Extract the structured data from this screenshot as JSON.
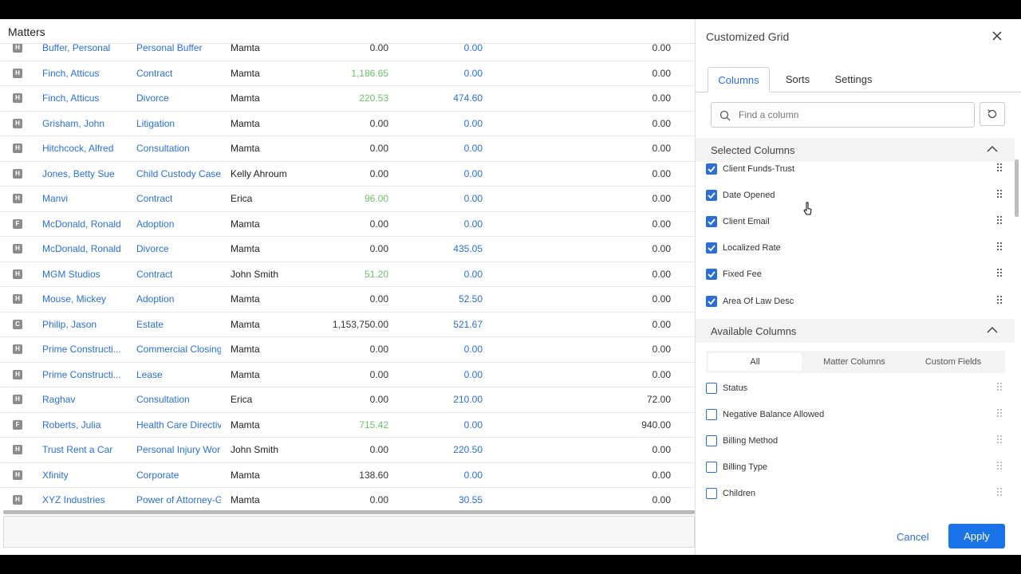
{
  "grid": {
    "title": "Matters",
    "rows": [
      {
        "badge": "H",
        "client": "Buffer, Personal",
        "area": "Personal Buffer",
        "atty": "Mamta",
        "n1": "0.00",
        "n2": "0.00",
        "n3": "0.00"
      },
      {
        "badge": "H",
        "client": "Finch, Atticus",
        "area": "Contract",
        "atty": "Mamta",
        "n1": "1,186.65",
        "n2": "0.00",
        "n3": "0.00"
      },
      {
        "badge": "H",
        "client": "Finch, Atticus",
        "area": "Divorce",
        "atty": "Mamta",
        "n1": "220.53",
        "n2": "474.60",
        "n3": "0.00"
      },
      {
        "badge": "H",
        "client": "Grisham, John",
        "area": "Litigation",
        "atty": "Mamta",
        "n1": "0.00",
        "n2": "0.00",
        "n3": "0.00"
      },
      {
        "badge": "H",
        "client": "Hitchcock, Alfred",
        "area": "Consultation",
        "atty": "Mamta",
        "n1": "0.00",
        "n2": "0.00",
        "n3": "0.00"
      },
      {
        "badge": "H",
        "client": "Jones, Betty Sue",
        "area": "Child Custody Case",
        "atty": "Kelly Ahroum",
        "n1": "0.00",
        "n2": "0.00",
        "n3": "0.00"
      },
      {
        "badge": "H",
        "client": "Manvi",
        "area": "Contract",
        "atty": "Erica",
        "n1": "96.00",
        "n2": "0.00",
        "n3": "0.00"
      },
      {
        "badge": "F",
        "client": "McDonald, Ronald",
        "area": "Adoption",
        "atty": "Mamta",
        "n1": "0.00",
        "n2": "0.00",
        "n3": "0.00"
      },
      {
        "badge": "H",
        "client": "McDonald, Ronald",
        "area": "Divorce",
        "atty": "Mamta",
        "n1": "0.00",
        "n2": "435.05",
        "n3": "0.00"
      },
      {
        "badge": "H",
        "client": "MGM Studios",
        "area": "Contract",
        "atty": "John Smith",
        "n1": "51.20",
        "n2": "0.00",
        "n3": "0.00"
      },
      {
        "badge": "H",
        "client": "Mouse, Mickey",
        "area": "Adoption",
        "atty": "Mamta",
        "n1": "0.00",
        "n2": "52.50",
        "n3": "0.00"
      },
      {
        "badge": "C",
        "client": "Philip, Jason",
        "area": "Estate",
        "atty": "Mamta",
        "n1": "1,153,750.00",
        "n2": "521.67",
        "n3": "0.00"
      },
      {
        "badge": "H",
        "client": "Prime Constructi...",
        "area": "Commercial Closing",
        "atty": "Mamta",
        "n1": "0.00",
        "n2": "0.00",
        "n3": "0.00"
      },
      {
        "badge": "H",
        "client": "Prime Constructi...",
        "area": "Lease",
        "atty": "Mamta",
        "n1": "0.00",
        "n2": "0.00",
        "n3": "0.00"
      },
      {
        "badge": "H",
        "client": "Raghav",
        "area": "Consultation",
        "atty": "Erica",
        "n1": "0.00",
        "n2": "210.00",
        "n3": "72.00"
      },
      {
        "badge": "F",
        "client": "Roberts, Julia",
        "area": "Health Care Directive",
        "atty": "Mamta",
        "n1": "715.42",
        "n2": "0.00",
        "n3": "940.00"
      },
      {
        "badge": "H",
        "client": "Trust Rent a Car",
        "area": "Personal Injury Work",
        "atty": "John Smith",
        "n1": "0.00",
        "n2": "220.50",
        "n3": "0.00"
      },
      {
        "badge": "H",
        "client": "Xfinity",
        "area": "Corporate",
        "atty": "Mamta",
        "n1": "138.60",
        "n2": "0.00",
        "n3": "0.00"
      },
      {
        "badge": "H",
        "client": "XYZ Industries",
        "area": "Power of Attorney-G",
        "atty": "Mamta",
        "n1": "0.00",
        "n2": "30.55",
        "n3": "0.00"
      }
    ]
  },
  "panel": {
    "title": "Customized Grid",
    "tabs": [
      "Columns",
      "Sorts",
      "Settings"
    ],
    "search_placeholder": "Find a column",
    "selected_header": "Selected Columns",
    "selected": [
      "Client Funds-Trust",
      "Date Opened",
      "Client Email",
      "Localized Rate",
      "Fixed Fee",
      "Area Of Law Desc"
    ],
    "available_header": "Available Columns",
    "filters": [
      "All",
      "Matter Columns",
      "Custom Fields"
    ],
    "available": [
      "Status",
      "Negative Balance Allowed",
      "Billing Method",
      "Billing Type",
      "Children"
    ],
    "cancel": "Cancel",
    "apply": "Apply"
  },
  "colors": {
    "accent": "#2b6fd6",
    "apply": "#1a73e8",
    "green": "#6cbf6c"
  },
  "icons": [
    "close-icon",
    "search-icon",
    "reset-icon",
    "chevron-up-icon",
    "drag-handle-icon",
    "mouse-cursor-icon"
  ]
}
